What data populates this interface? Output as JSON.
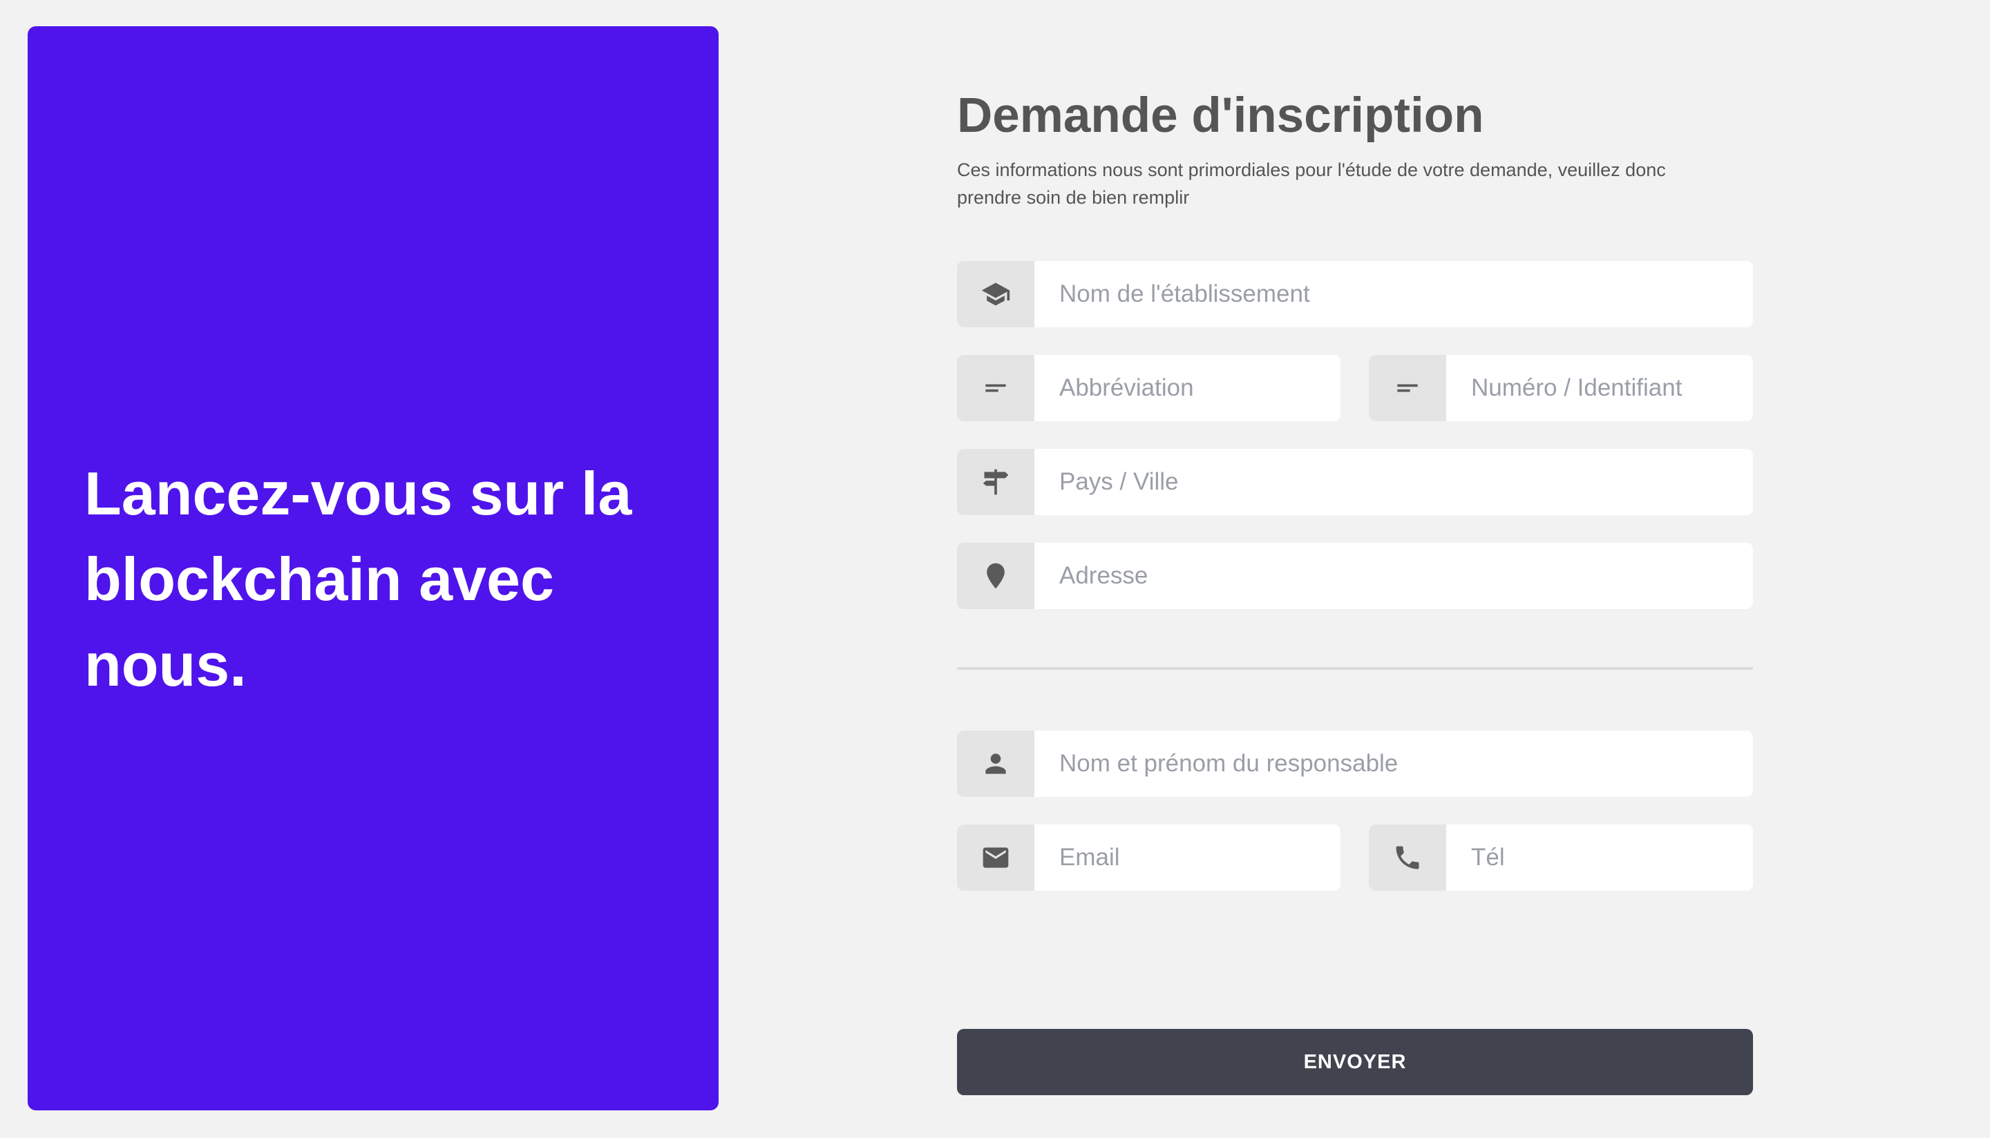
{
  "hero": {
    "headline": "Lancez-vous sur la blockchain avec nous.",
    "background_color": "#4f14ec"
  },
  "form": {
    "title": "Demande d'inscription",
    "subtitle": "Ces informations nous sont primordiales pour l'étude de votre demande, veuillez donc prendre soin de bien remplir",
    "fields": {
      "establishment": {
        "icon": "graduation-cap-icon",
        "placeholder": "Nom de l'établissement",
        "value": ""
      },
      "abbreviation": {
        "icon": "short-text-icon",
        "placeholder": "Abbréviation",
        "value": ""
      },
      "identifier": {
        "icon": "short-text-icon",
        "placeholder": "Numéro / Identifiant",
        "value": ""
      },
      "country_city": {
        "icon": "signpost-icon",
        "placeholder": "Pays / Ville",
        "value": ""
      },
      "address": {
        "icon": "map-pin-icon",
        "placeholder": "Adresse",
        "value": ""
      },
      "manager_name": {
        "icon": "user-icon",
        "placeholder": "Nom et prénom du responsable",
        "value": ""
      },
      "email": {
        "icon": "envelope-icon",
        "placeholder": "Email",
        "value": ""
      },
      "phone": {
        "icon": "phone-icon",
        "placeholder": "Tél",
        "value": ""
      }
    },
    "submit_label": "ENVOYER",
    "submit_color": "#41444f"
  }
}
